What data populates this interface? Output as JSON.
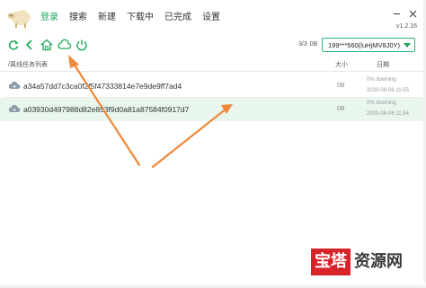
{
  "app": {
    "version": "v1.2.16",
    "logo_icon": "sheep-logo-icon"
  },
  "nav": {
    "items": [
      {
        "label": "登录",
        "active": true
      },
      {
        "label": "搜索",
        "active": false
      },
      {
        "label": "新建",
        "active": false
      },
      {
        "label": "下载中",
        "active": false
      },
      {
        "label": "已完成",
        "active": false
      },
      {
        "label": "设置",
        "active": false
      }
    ]
  },
  "window_controls": {
    "minimize": "minimize-icon",
    "close": "close-icon"
  },
  "toolbar": {
    "icons": [
      "refresh-icon",
      "back-icon",
      "home-icon",
      "cloud-download-icon",
      "power-icon"
    ],
    "count": "3/3",
    "size": "0B",
    "account": "199***560(luHjMV8J0Y)"
  },
  "list": {
    "path": "/离线任务列表",
    "col_size": "大小",
    "col_date": "日期",
    "rows": [
      {
        "name": "a34a57dd7c3ca0f2f5f47333814e7e9de9ff7ad4",
        "size": "0B",
        "status": "0% downing",
        "date": "2020-08-06 11:55",
        "selected": false
      },
      {
        "name": "a03930d497988d82e853f9d0a81a87584f0917d7",
        "size": "0B",
        "status": "0% downing",
        "date": "2020-08-06 11:54",
        "selected": true
      }
    ]
  },
  "colors": {
    "accent": "#1aaa55",
    "arrow": "#f0883a",
    "selected_row": "#e9f6ee",
    "watermark_red": "#d9232a"
  },
  "watermark": {
    "boxed": "宝塔",
    "rest": "资源网"
  }
}
